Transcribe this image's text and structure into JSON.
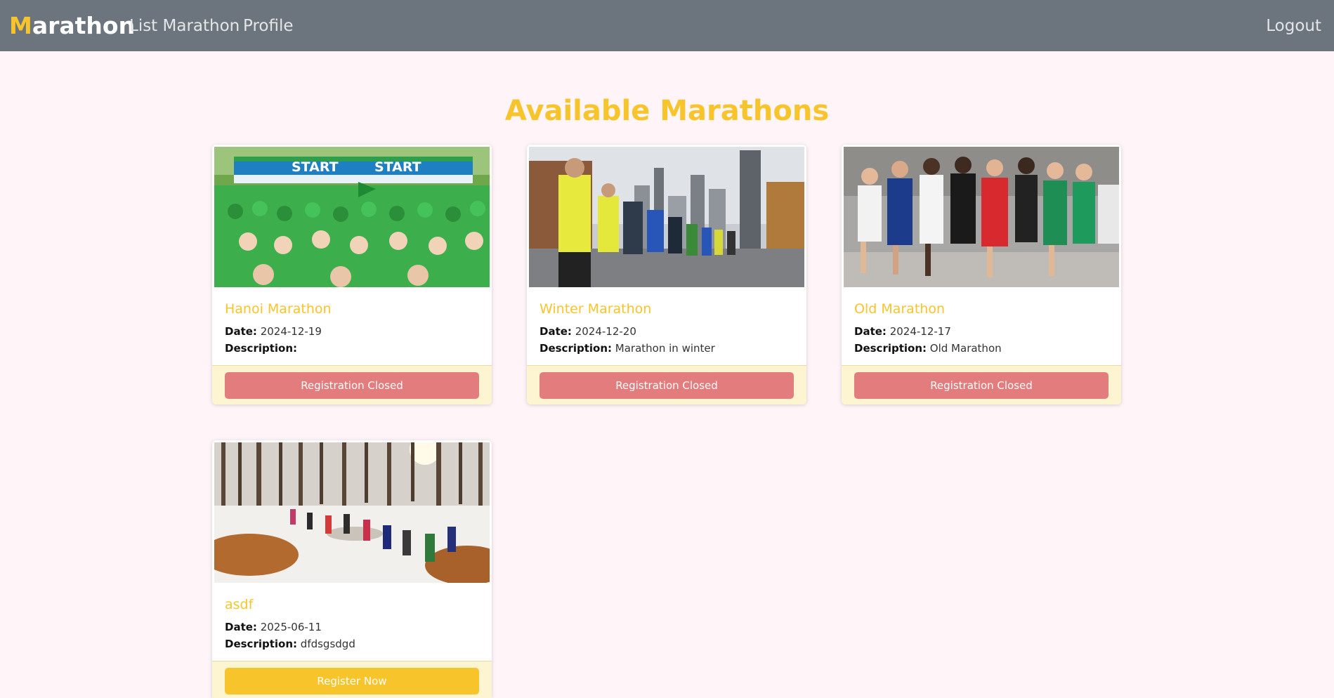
{
  "navbar": {
    "brand_first": "M",
    "brand_rest": "arathon",
    "links": {
      "list": "List Marathon",
      "profile": "Profile",
      "logout": "Logout"
    }
  },
  "page": {
    "title": "Available Marathons"
  },
  "labels": {
    "date": "Date:",
    "description": "Description:"
  },
  "colors": {
    "accent": "#f7c52b",
    "navbar": "#6c757d",
    "background": "#fff4f8",
    "closed_button": "#e37c7c"
  },
  "marathons": [
    {
      "name": "Hanoi Marathon",
      "date": "2024-12-19",
      "description": "",
      "button": "Registration Closed",
      "status": "closed"
    },
    {
      "name": "Winter Marathon",
      "date": "2024-12-20",
      "description": "Marathon in winter",
      "button": "Registration Closed",
      "status": "closed"
    },
    {
      "name": "Old Marathon",
      "date": "2024-12-17",
      "description": "Old Marathon",
      "button": "Registration Closed",
      "status": "closed"
    },
    {
      "name": "asdf",
      "date": "2025-06-11",
      "description": "dfdsgsdgd",
      "button": "Register Now",
      "status": "open"
    }
  ]
}
